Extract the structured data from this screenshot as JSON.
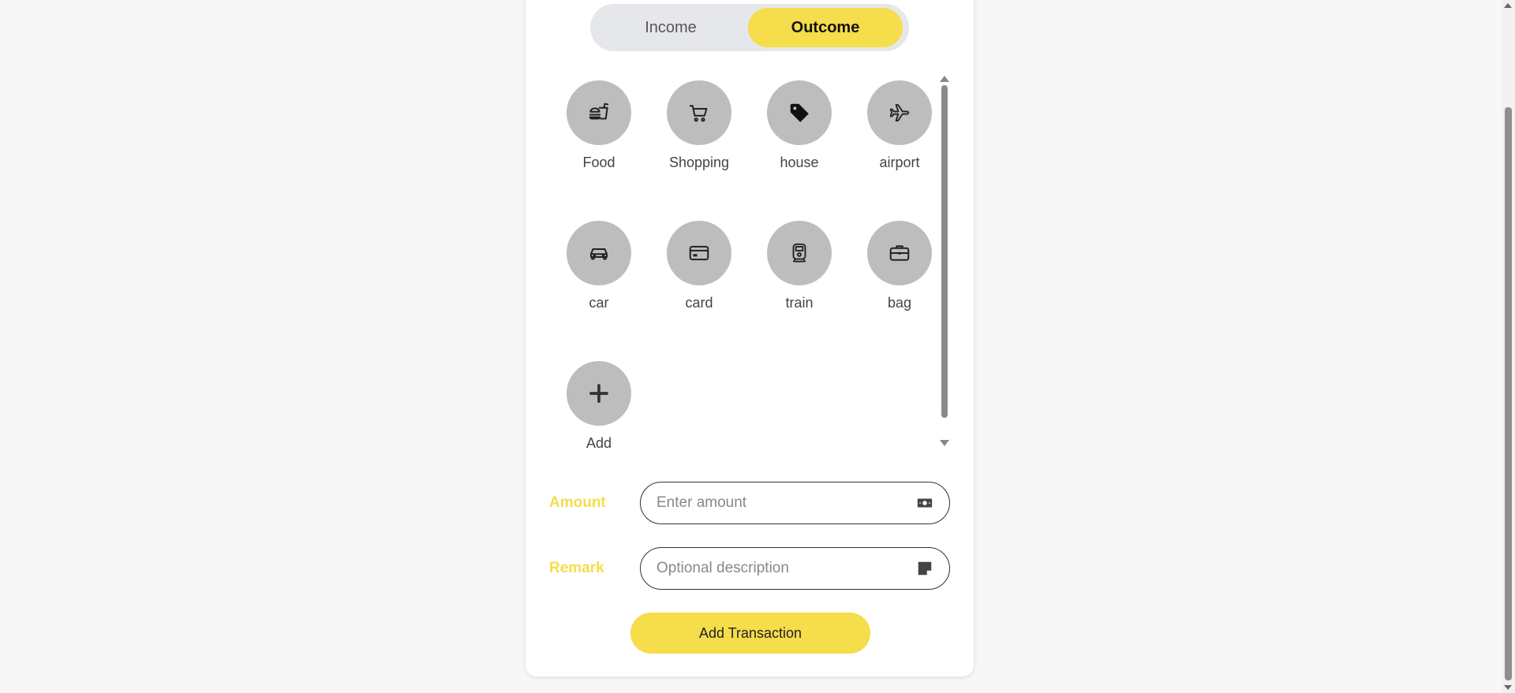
{
  "toggle": {
    "income_label": "Income",
    "outcome_label": "Outcome",
    "selected": "Outcome"
  },
  "categories": [
    {
      "label": "Food",
      "icon": "fast-food-icon"
    },
    {
      "label": "Shopping",
      "icon": "cart-icon"
    },
    {
      "label": "house",
      "icon": "tag-icon"
    },
    {
      "label": "airport",
      "icon": "airplane-icon"
    },
    {
      "label": "car",
      "icon": "car-icon"
    },
    {
      "label": "card",
      "icon": "credit-card-icon"
    },
    {
      "label": "train",
      "icon": "train-icon"
    },
    {
      "label": "bag",
      "icon": "briefcase-icon"
    },
    {
      "label": "Add",
      "icon": "plus-icon"
    }
  ],
  "form": {
    "amount_label": "Amount",
    "amount_placeholder": "Enter amount",
    "remark_label": "Remark",
    "remark_placeholder": "Optional description"
  },
  "submit_label": "Add Transaction",
  "colors": {
    "accent": "#f5dd4b",
    "circle": "#bdbdbd",
    "toggle_bg": "#e6e7eb"
  }
}
